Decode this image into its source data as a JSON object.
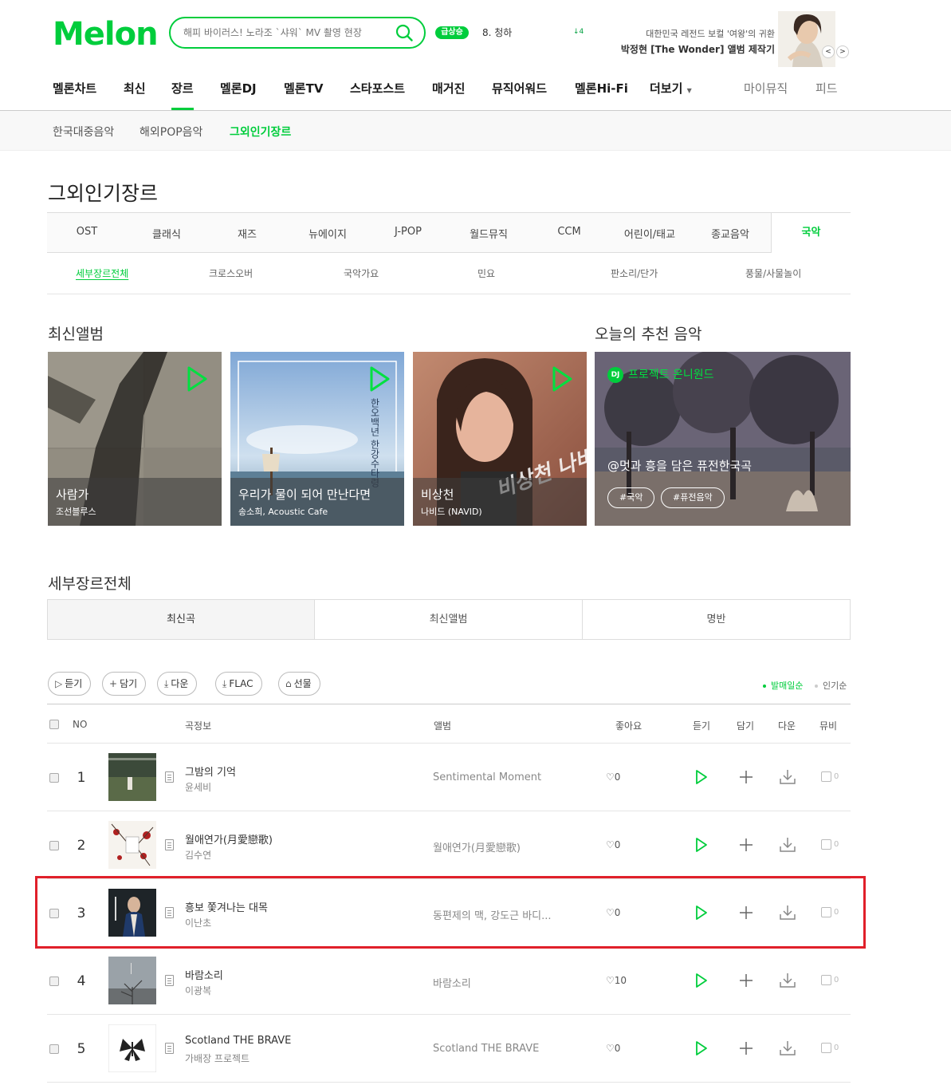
{
  "header": {
    "logo": "Melon",
    "search_placeholder": "해피 바이러스! 노라조 `샤워` MV 촬영 현장",
    "rise_badge": "급상승",
    "rise_text": "8. 청하",
    "rise_change": "4",
    "promo_line1": "대한민국 레전드 보컬 '여왕'의 귀환",
    "promo_line2": "박정현 [The Wonder] 앨범 제작기"
  },
  "gnb": {
    "items": [
      "멜론차트",
      "최신",
      "장르",
      "멜론DJ",
      "멜론TV",
      "스타포스트",
      "매거진",
      "뮤직어워드",
      "멜론Hi-Fi",
      "더보기"
    ],
    "right": [
      "마이뮤직",
      "피드"
    ]
  },
  "sub_nav": [
    "한국대중음악",
    "해외POP음악",
    "그외인기장르"
  ],
  "page_title": "그외인기장르",
  "genre_tabs": [
    "OST",
    "클래식",
    "재즈",
    "뉴에이지",
    "J-POP",
    "월드뮤직",
    "CCM",
    "어린이/태교",
    "종교음악",
    "국악"
  ],
  "subgenres": [
    "세부장르전체",
    "크로스오버",
    "국악가요",
    "민요",
    "판소리/단가",
    "풍물/사물놀이"
  ],
  "new_albums": {
    "title": "최신앨범",
    "items": [
      {
        "title": "사람가",
        "artist": "조선블루스"
      },
      {
        "title": "우리가 물이 되어 만난다면",
        "artist": "송소희, Acoustic Cafe",
        "cover_text": "한오백년 한강수타령"
      },
      {
        "title": "비상천",
        "artist": "나비드 (NAVID)",
        "cover_text": "비상천 나비드"
      }
    ]
  },
  "recommend": {
    "title": "오늘의 추천 음악",
    "dj_badge": "DJ",
    "dj_name": "프로젝트 온니원드",
    "card_title": "@멋과 흥을 담은 퓨전한국곡",
    "tags": [
      "#국악",
      "#퓨전음악"
    ]
  },
  "list_section": {
    "title": "세부장르전체",
    "tabs": [
      "최신곡",
      "최신앨범",
      "명반"
    ],
    "buttons": [
      "듣기",
      "담기",
      "다운",
      "FLAC",
      "선물"
    ],
    "sort": [
      "발매일순",
      "인기순"
    ]
  },
  "table_headers": [
    "NO",
    "곡정보",
    "앨범",
    "좋아요",
    "듣기",
    "담기",
    "다운",
    "뮤비"
  ],
  "songs": [
    {
      "no": "1",
      "title": "그밤의 기억",
      "artist": "윤세비",
      "album": "Sentimental Moment",
      "likes": "0",
      "mv": "0"
    },
    {
      "no": "2",
      "title": "월애연가(月愛戀歌)",
      "artist": "김수연",
      "album": "월애연가(月愛戀歌)",
      "likes": "0",
      "mv": "0"
    },
    {
      "no": "3",
      "title": "흥보 쫓겨나는 대목",
      "artist": "이난초",
      "album": "동편제의 맥, 강도근 바디...",
      "likes": "0",
      "mv": "0"
    },
    {
      "no": "4",
      "title": "바람소리",
      "artist": "이광복",
      "album": "바람소리",
      "likes": "10",
      "mv": "0"
    },
    {
      "no": "5",
      "title": "Scotland THE BRAVE",
      "artist": "가배장 프로젝트",
      "album": "Scotland THE BRAVE",
      "likes": "0",
      "mv": "0"
    }
  ],
  "colors": {
    "accent": "#00cd3c",
    "highlight": "#e0202a"
  }
}
